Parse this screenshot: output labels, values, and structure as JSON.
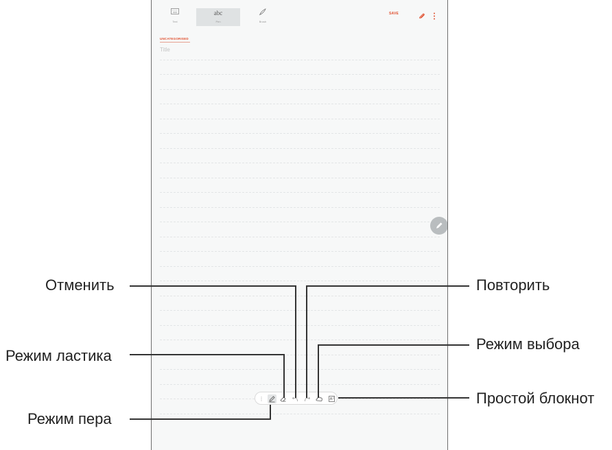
{
  "toolbar": {
    "tabs": [
      {
        "label": "Text",
        "icon": "keyboard-icon"
      },
      {
        "label": "Pen",
        "icon": "handwriting-icon",
        "glyph": "abc"
      },
      {
        "label": "Brush",
        "icon": "brush-icon"
      }
    ],
    "save_label": "SAVE",
    "attach_icon": "paperclip-icon",
    "more_icon": "more-vertical-icon"
  },
  "note": {
    "category": "UNCATEGORISED",
    "title_placeholder": "Title"
  },
  "pen_toolbar": {
    "tools": [
      "pen-mode-icon",
      "eraser-mode-icon",
      "undo-icon",
      "redo-icon",
      "selection-mode-icon",
      "simple-notepad-icon"
    ]
  },
  "callouts": {
    "undo": "Отменить",
    "redo": "Повторить",
    "eraser": "Режим ластика",
    "selection": "Режим выбора",
    "simple_notepad": "Простой блокнот",
    "pen": "Режим пера"
  },
  "colors": {
    "accent": "#e0502f",
    "background": "#f7f8f8",
    "frame": "#6d6d6d"
  }
}
